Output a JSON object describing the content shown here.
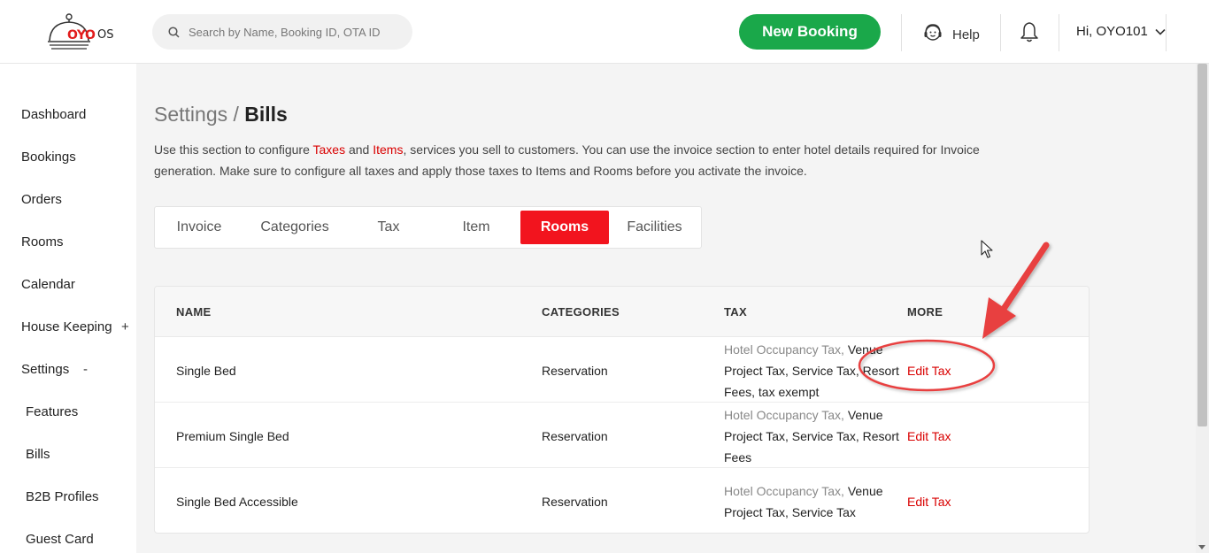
{
  "header": {
    "logo": {
      "brand": "OYO",
      "suffix": "OS"
    },
    "search": {
      "placeholder": "Search by Name, Booking ID, OTA ID"
    },
    "new_booking_label": "New Booking",
    "help_label": "Help",
    "user_label": "Hi, OYO101"
  },
  "sidebar": {
    "items": [
      {
        "label": "Dashboard"
      },
      {
        "label": "Bookings"
      },
      {
        "label": "Orders"
      },
      {
        "label": "Rooms"
      },
      {
        "label": "Calendar"
      },
      {
        "label": "House Keeping",
        "toggle": "+"
      },
      {
        "label": "Settings",
        "toggle": "-"
      },
      {
        "label": "Features"
      },
      {
        "label": "Bills"
      },
      {
        "label": "B2B Profiles"
      },
      {
        "label": "Guest Card"
      }
    ]
  },
  "page": {
    "breadcrumb_parent": "Settings",
    "breadcrumb_sep": " / ",
    "breadcrumb_current": "Bills",
    "description": {
      "part1": "Use this section to configure ",
      "link_taxes": "Taxes",
      "part2": " and ",
      "link_items": "Items",
      "part3": ", services you sell to customers. You can use the invoice section to enter hotel details required for Invoice generation. Make sure to configure all taxes and apply those taxes to Items and Rooms before you activate the invoice."
    }
  },
  "tabs": [
    {
      "label": "Invoice",
      "active": false
    },
    {
      "label": "Categories",
      "active": false
    },
    {
      "label": "Tax",
      "active": false
    },
    {
      "label": "Item",
      "active": false
    },
    {
      "label": "Rooms",
      "active": true
    },
    {
      "label": "Facilities",
      "active": false
    }
  ],
  "table": {
    "columns": [
      "NAME",
      "CATEGORIES",
      "TAX",
      "MORE"
    ],
    "rows": [
      {
        "name": "Single Bed",
        "category": "Reservation",
        "tax_gray": "Hotel Occupancy Tax, ",
        "tax_dark": "Venue Project Tax, Service Tax, Resort Fees, tax exempt",
        "more": "Edit Tax"
      },
      {
        "name": "Premium Single Bed",
        "category": "Reservation",
        "tax_gray": "Hotel Occupancy Tax, ",
        "tax_dark": "Venue Project Tax, Service Tax, Resort Fees",
        "more": "Edit Tax"
      },
      {
        "name": "Single Bed Accessible",
        "category": "Reservation",
        "tax_gray": "Hotel Occupancy Tax, ",
        "tax_dark": "Venue Project Tax, Service Tax",
        "more": "Edit Tax"
      }
    ]
  },
  "colors": {
    "brand_red": "#f2141e",
    "link_red": "#d90000",
    "green": "#1aa84a",
    "annotation_red": "#e8403f"
  }
}
